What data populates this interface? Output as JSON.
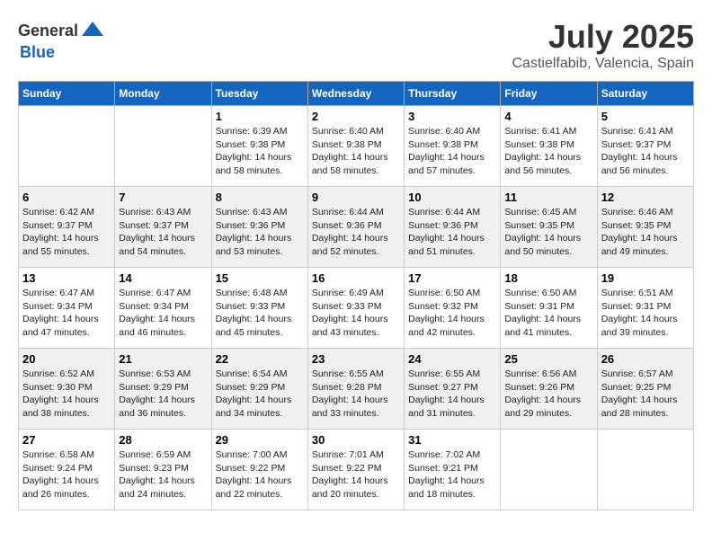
{
  "header": {
    "logo_general": "General",
    "logo_blue": "Blue",
    "month": "July 2025",
    "location": "Castielfabib, Valencia, Spain"
  },
  "weekdays": [
    "Sunday",
    "Monday",
    "Tuesday",
    "Wednesday",
    "Thursday",
    "Friday",
    "Saturday"
  ],
  "weeks": [
    [
      {
        "day": "",
        "sunrise": "",
        "sunset": "",
        "daylight": ""
      },
      {
        "day": "",
        "sunrise": "",
        "sunset": "",
        "daylight": ""
      },
      {
        "day": "1",
        "sunrise": "Sunrise: 6:39 AM",
        "sunset": "Sunset: 9:38 PM",
        "daylight": "Daylight: 14 hours and 58 minutes."
      },
      {
        "day": "2",
        "sunrise": "Sunrise: 6:40 AM",
        "sunset": "Sunset: 9:38 PM",
        "daylight": "Daylight: 14 hours and 58 minutes."
      },
      {
        "day": "3",
        "sunrise": "Sunrise: 6:40 AM",
        "sunset": "Sunset: 9:38 PM",
        "daylight": "Daylight: 14 hours and 57 minutes."
      },
      {
        "day": "4",
        "sunrise": "Sunrise: 6:41 AM",
        "sunset": "Sunset: 9:38 PM",
        "daylight": "Daylight: 14 hours and 56 minutes."
      },
      {
        "day": "5",
        "sunrise": "Sunrise: 6:41 AM",
        "sunset": "Sunset: 9:37 PM",
        "daylight": "Daylight: 14 hours and 56 minutes."
      }
    ],
    [
      {
        "day": "6",
        "sunrise": "Sunrise: 6:42 AM",
        "sunset": "Sunset: 9:37 PM",
        "daylight": "Daylight: 14 hours and 55 minutes."
      },
      {
        "day": "7",
        "sunrise": "Sunrise: 6:43 AM",
        "sunset": "Sunset: 9:37 PM",
        "daylight": "Daylight: 14 hours and 54 minutes."
      },
      {
        "day": "8",
        "sunrise": "Sunrise: 6:43 AM",
        "sunset": "Sunset: 9:36 PM",
        "daylight": "Daylight: 14 hours and 53 minutes."
      },
      {
        "day": "9",
        "sunrise": "Sunrise: 6:44 AM",
        "sunset": "Sunset: 9:36 PM",
        "daylight": "Daylight: 14 hours and 52 minutes."
      },
      {
        "day": "10",
        "sunrise": "Sunrise: 6:44 AM",
        "sunset": "Sunset: 9:36 PM",
        "daylight": "Daylight: 14 hours and 51 minutes."
      },
      {
        "day": "11",
        "sunrise": "Sunrise: 6:45 AM",
        "sunset": "Sunset: 9:35 PM",
        "daylight": "Daylight: 14 hours and 50 minutes."
      },
      {
        "day": "12",
        "sunrise": "Sunrise: 6:46 AM",
        "sunset": "Sunset: 9:35 PM",
        "daylight": "Daylight: 14 hours and 49 minutes."
      }
    ],
    [
      {
        "day": "13",
        "sunrise": "Sunrise: 6:47 AM",
        "sunset": "Sunset: 9:34 PM",
        "daylight": "Daylight: 14 hours and 47 minutes."
      },
      {
        "day": "14",
        "sunrise": "Sunrise: 6:47 AM",
        "sunset": "Sunset: 9:34 PM",
        "daylight": "Daylight: 14 hours and 46 minutes."
      },
      {
        "day": "15",
        "sunrise": "Sunrise: 6:48 AM",
        "sunset": "Sunset: 9:33 PM",
        "daylight": "Daylight: 14 hours and 45 minutes."
      },
      {
        "day": "16",
        "sunrise": "Sunrise: 6:49 AM",
        "sunset": "Sunset: 9:33 PM",
        "daylight": "Daylight: 14 hours and 43 minutes."
      },
      {
        "day": "17",
        "sunrise": "Sunrise: 6:50 AM",
        "sunset": "Sunset: 9:32 PM",
        "daylight": "Daylight: 14 hours and 42 minutes."
      },
      {
        "day": "18",
        "sunrise": "Sunrise: 6:50 AM",
        "sunset": "Sunset: 9:31 PM",
        "daylight": "Daylight: 14 hours and 41 minutes."
      },
      {
        "day": "19",
        "sunrise": "Sunrise: 6:51 AM",
        "sunset": "Sunset: 9:31 PM",
        "daylight": "Daylight: 14 hours and 39 minutes."
      }
    ],
    [
      {
        "day": "20",
        "sunrise": "Sunrise: 6:52 AM",
        "sunset": "Sunset: 9:30 PM",
        "daylight": "Daylight: 14 hours and 38 minutes."
      },
      {
        "day": "21",
        "sunrise": "Sunrise: 6:53 AM",
        "sunset": "Sunset: 9:29 PM",
        "daylight": "Daylight: 14 hours and 36 minutes."
      },
      {
        "day": "22",
        "sunrise": "Sunrise: 6:54 AM",
        "sunset": "Sunset: 9:29 PM",
        "daylight": "Daylight: 14 hours and 34 minutes."
      },
      {
        "day": "23",
        "sunrise": "Sunrise: 6:55 AM",
        "sunset": "Sunset: 9:28 PM",
        "daylight": "Daylight: 14 hours and 33 minutes."
      },
      {
        "day": "24",
        "sunrise": "Sunrise: 6:55 AM",
        "sunset": "Sunset: 9:27 PM",
        "daylight": "Daylight: 14 hours and 31 minutes."
      },
      {
        "day": "25",
        "sunrise": "Sunrise: 6:56 AM",
        "sunset": "Sunset: 9:26 PM",
        "daylight": "Daylight: 14 hours and 29 minutes."
      },
      {
        "day": "26",
        "sunrise": "Sunrise: 6:57 AM",
        "sunset": "Sunset: 9:25 PM",
        "daylight": "Daylight: 14 hours and 28 minutes."
      }
    ],
    [
      {
        "day": "27",
        "sunrise": "Sunrise: 6:58 AM",
        "sunset": "Sunset: 9:24 PM",
        "daylight": "Daylight: 14 hours and 26 minutes."
      },
      {
        "day": "28",
        "sunrise": "Sunrise: 6:59 AM",
        "sunset": "Sunset: 9:23 PM",
        "daylight": "Daylight: 14 hours and 24 minutes."
      },
      {
        "day": "29",
        "sunrise": "Sunrise: 7:00 AM",
        "sunset": "Sunset: 9:22 PM",
        "daylight": "Daylight: 14 hours and 22 minutes."
      },
      {
        "day": "30",
        "sunrise": "Sunrise: 7:01 AM",
        "sunset": "Sunset: 9:22 PM",
        "daylight": "Daylight: 14 hours and 20 minutes."
      },
      {
        "day": "31",
        "sunrise": "Sunrise: 7:02 AM",
        "sunset": "Sunset: 9:21 PM",
        "daylight": "Daylight: 14 hours and 18 minutes."
      },
      {
        "day": "",
        "sunrise": "",
        "sunset": "",
        "daylight": ""
      },
      {
        "day": "",
        "sunrise": "",
        "sunset": "",
        "daylight": ""
      }
    ]
  ]
}
